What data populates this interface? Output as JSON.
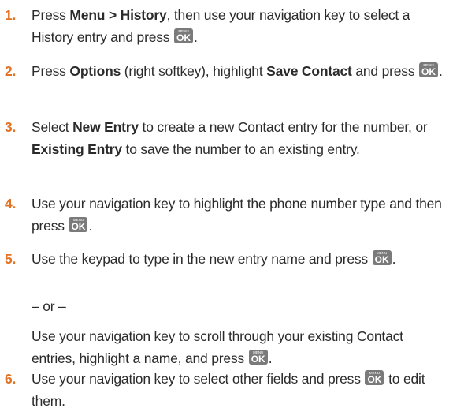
{
  "key": {
    "top": "MENU",
    "main": "OK"
  },
  "steps": [
    {
      "number": "1.",
      "t1": "Press ",
      "b1": "Menu > History",
      "t2": ", then use your navigation key to select a History entry and press ",
      "t3": "."
    },
    {
      "number": "2.",
      "t1": "Press ",
      "b1": "Options",
      "t2": " (right softkey), highlight ",
      "b2": "Save Contact",
      "t3": " and press ",
      "t4": "."
    },
    {
      "number": "3.",
      "t1": "Select ",
      "b1": "New Entry",
      "t2": " to create a new Contact entry for the number, or ",
      "b2": "Existing Entry",
      "t3": " to save the number to an existing entry."
    },
    {
      "number": "4.",
      "t1": "Use your navigation key to highlight the phone number type and then press ",
      "t2": "."
    },
    {
      "number": "5.",
      "t1": "Use the keypad to type in the new entry name and press ",
      "t2": ".",
      "or": "– or –",
      "alt": "Use your navigation key to scroll through your existing Contact entries, highlight a name, and press ",
      "alt_end": "."
    },
    {
      "number": "6.",
      "t1": "Use your navigation key to select other fields and press ",
      "t2": " to edit them."
    }
  ]
}
